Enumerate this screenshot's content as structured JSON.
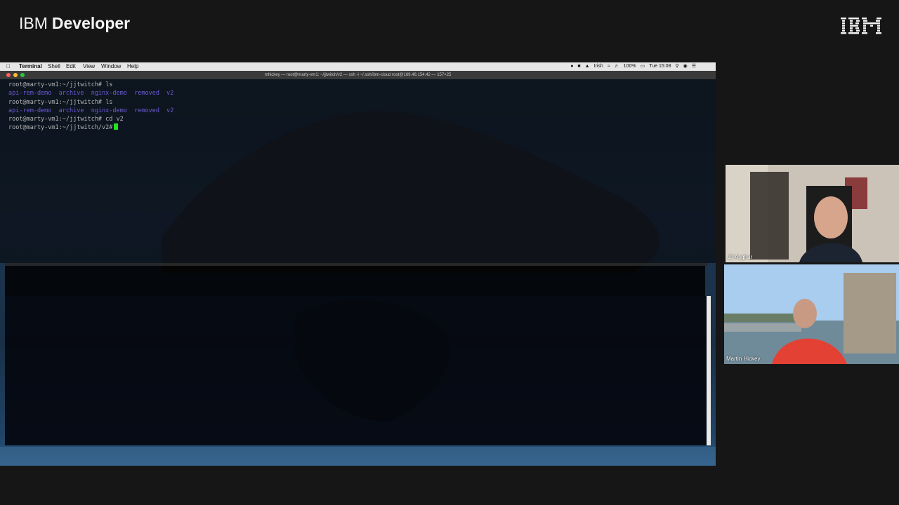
{
  "brand": {
    "light": "IBM",
    "bold": "Developer"
  },
  "menubar": {
    "items": [
      "Terminal",
      "Shell",
      "Edit",
      "View",
      "Window",
      "Help"
    ],
    "status": {
      "wifi": "Irish",
      "battery": "100%",
      "time": "Tue 15:08"
    }
  },
  "window": {
    "title": "mhickey — root@marty-vm1: ~/jjtwitch/v2 — ssh -i ~/.ssh/ibm-cloud root@169.48.154.42 — 157×25"
  },
  "terminal": {
    "lines": [
      {
        "text": "root@marty-vm1:~/jjtwitch# ls",
        "kind": "prompt"
      },
      {
        "text": "api-rem-demo  archive  nginx-demo  removed  v2",
        "kind": "dir"
      },
      {
        "text": "root@marty-vm1:~/jjtwitch# ls",
        "kind": "prompt"
      },
      {
        "text": "api-rem-demo  archive  nginx-demo  removed  v2",
        "kind": "dir"
      },
      {
        "text": "root@marty-vm1:~/jjtwitch# cd v2",
        "kind": "prompt"
      },
      {
        "text": "root@marty-vm1:~/jjtwitch/v2#",
        "kind": "prompt"
      }
    ]
  },
  "participants": [
    {
      "name": "JJ Asghar"
    },
    {
      "name": "Martin Hickey"
    }
  ],
  "colors": {
    "cursor": "#1ee51e",
    "active_speaker": "#f5d74a",
    "dir": "#6d5bd8"
  }
}
